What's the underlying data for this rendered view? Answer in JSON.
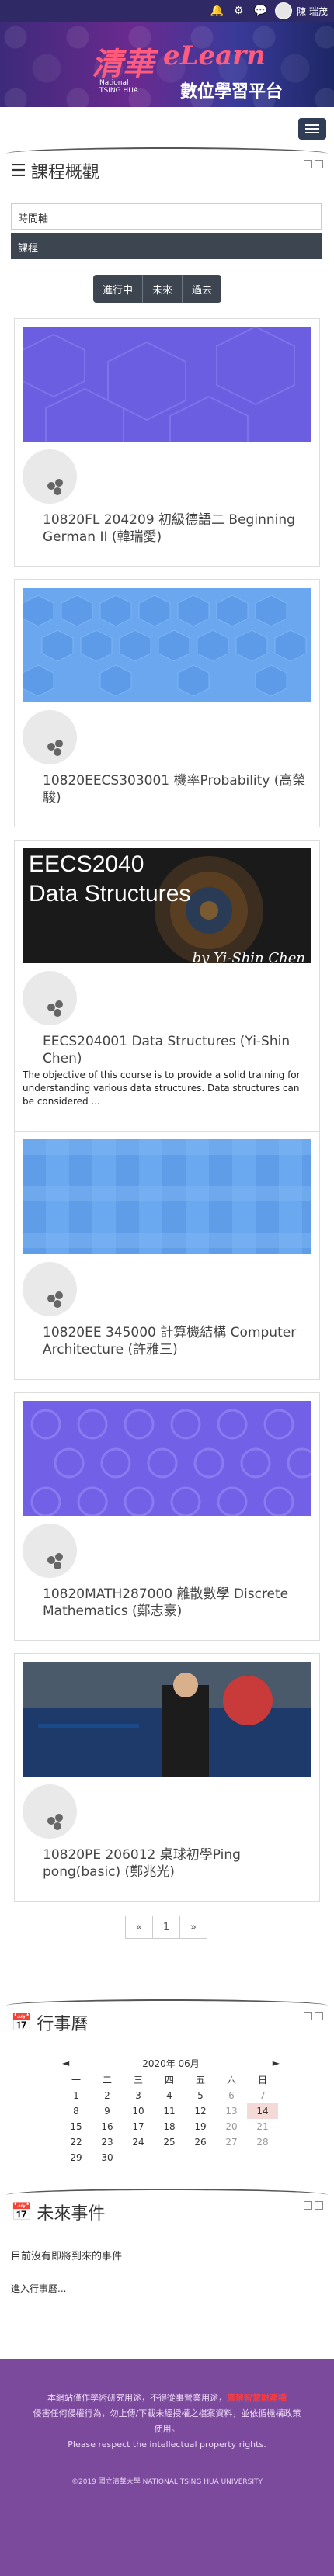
{
  "topbar": {
    "user_name": "陳 瑞茂"
  },
  "banner": {
    "logo_cn": "清華",
    "logo_en_1": "National",
    "logo_en_2": "TSING HUA",
    "brand": "eLearn",
    "brand_sub": "數位學習平台"
  },
  "overview": {
    "title": "課程概觀",
    "filter_sort": "時間軸",
    "filter_view": "課程",
    "tabs": [
      "進行中",
      "未來",
      "過去"
    ]
  },
  "courses": [
    {
      "name": "10820FL 204209 初級德語二 Beginning German II (韓瑞愛)"
    },
    {
      "name": "10820EECS303001 機率Probability (高榮駿)"
    },
    {
      "name": "EECS204001 Data Structures (Yi-Shin Chen)",
      "image_text_1": "EECS2040",
      "image_text_2": "Data Structures",
      "image_text_3": "by Yi-Shin Chen",
      "summary": "The objective of this course is to provide a solid training for understanding various data structures. Data structures can be considered ..."
    },
    {
      "name": "10820EE 345000 計算機結構 Computer Architecture (許雅三)"
    },
    {
      "name": "10820MATH287000 離散數學 Discrete Mathematics (鄭志豪)"
    },
    {
      "name": "10820PE 206012 桌球初學Ping pong(basic) (鄭兆光)"
    }
  ],
  "pager": {
    "prev": "«",
    "page": "1",
    "next": "»"
  },
  "calendar": {
    "title": "行事曆",
    "prev": "◄",
    "month": "2020年 06月",
    "next": "►",
    "weekdays": [
      "一",
      "二",
      "三",
      "四",
      "五",
      "六",
      "日"
    ],
    "weeks": [
      [
        "1",
        "2",
        "3",
        "4",
        "5",
        "6",
        "7"
      ],
      [
        "8",
        "9",
        "10",
        "11",
        "12",
        "13",
        "14"
      ],
      [
        "15",
        "16",
        "17",
        "18",
        "19",
        "20",
        "21"
      ],
      [
        "22",
        "23",
        "24",
        "25",
        "26",
        "27",
        "28"
      ],
      [
        "29",
        "30",
        "",
        "",
        "",
        "",
        ""
      ]
    ]
  },
  "upcoming": {
    "title": "未來事件",
    "empty": "目前沒有即將到來的事件",
    "link": "進入行事曆..."
  },
  "footer": {
    "line1a": "本網站僅作學術研究用途，不得從事營業用途，",
    "line1b": "嚴禁智慧財產權",
    "line2": "侵害任何侵權行為，勿上傳/下載未經授權之檔案資料，並依循機構政策",
    "line3": "使用。",
    "line4": "Please respect the intellectual property rights.",
    "copy": "©2019 國立清華大學 NATIONAL TSING HUA UNIVERSITY"
  },
  "colors": {
    "nav_dark": "#2f2a66",
    "button_dark": "#3d4650",
    "footer": "#7b4a9c",
    "accent": "#ff5b7e"
  }
}
